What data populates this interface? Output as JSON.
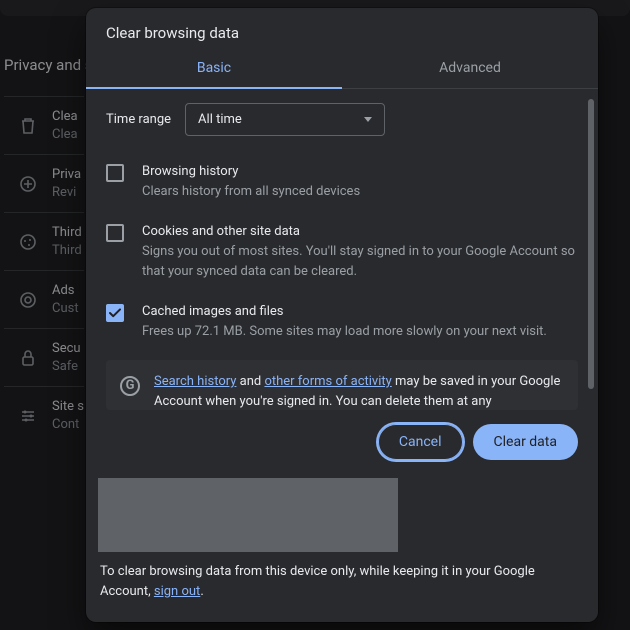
{
  "bg_page": {
    "section_title": "Privacy and s",
    "rows": [
      {
        "icon": "trash-icon",
        "line1": "Clea",
        "line2": "Clea"
      },
      {
        "icon": "plus-circle-icon",
        "line1": "Priva",
        "line2": "Revi"
      },
      {
        "icon": "cookie-icon",
        "line1": "Third",
        "line2": "Third"
      },
      {
        "icon": "target-icon",
        "line1": "Ads",
        "line2": "Cust"
      },
      {
        "icon": "lock-icon",
        "line1": "Secu",
        "line2": "Safe"
      },
      {
        "icon": "sliders-icon",
        "line1": "Site s",
        "line2": "Cont"
      }
    ]
  },
  "dialog": {
    "title": "Clear browsing data",
    "tabs": {
      "basic": "Basic",
      "advanced": "Advanced"
    },
    "time_range_label": "Time range",
    "time_range_value": "All time",
    "options": [
      {
        "key": "history",
        "checked": false,
        "title": "Browsing history",
        "desc": "Clears history from all synced devices"
      },
      {
        "key": "cookies",
        "checked": false,
        "title": "Cookies and other site data",
        "desc": "Signs you out of most sites. You'll stay signed in to your Google Account so that your synced data can be cleared."
      },
      {
        "key": "cache",
        "checked": true,
        "title": "Cached images and files",
        "desc": "Frees up 72.1 MB. Some sites may load more slowly on your next visit."
      }
    ],
    "info_card": {
      "link1": "Search history",
      "mid1": " and ",
      "link2": "other forms of activity",
      "mid2": " may be saved in your Google Account when you're signed in. You can delete them at any"
    },
    "actions": {
      "cancel": "Cancel",
      "clear": "Clear data"
    },
    "footer_pre": "To clear browsing data from this device only, while keeping it in your Google Account, ",
    "footer_link": "sign out",
    "footer_post": "."
  }
}
